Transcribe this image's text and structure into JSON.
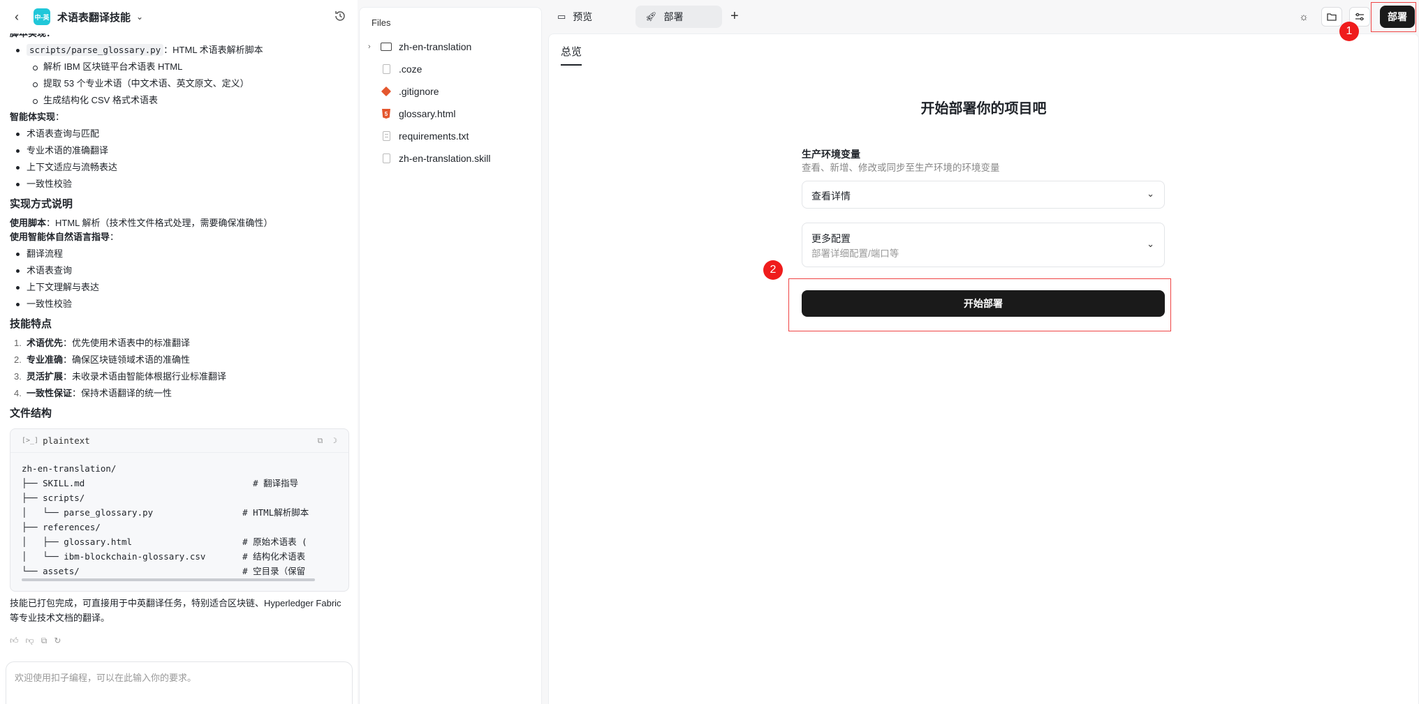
{
  "header": {
    "app_title": "术语表翻译技能",
    "app_logo_text": "中-英"
  },
  "chat": {
    "cut_heading": "脚本实现：",
    "script_item_code": "scripts/parse_glossary.py",
    "script_item_text": "：HTML 术语表解析脚本",
    "script_sub": [
      "解析 IBM 区块链平台术语表 HTML",
      "提取 53 个专业术语（中文术语、英文原文、定义）",
      "生成结构化 CSV 格式术语表"
    ],
    "agent_heading": "智能体实现",
    "agent_heading_colon": "：",
    "agent_items": [
      "术语表查询与匹配",
      "专业术语的准确翻译",
      "上下文适应与流畅表达",
      "一致性校验"
    ],
    "impl_title": "实现方式说明",
    "use_script_label": "使用脚本",
    "use_script_text": "：HTML 解析（技术性文件格式处理，需要确保准确性）",
    "use_agent_label": "使用智能体自然语言指导",
    "use_agent_colon": "：",
    "use_agent_items": [
      "翻译流程",
      "术语表查询",
      "上下文理解与表达",
      "一致性校验"
    ],
    "features_title": "技能特点",
    "features": [
      {
        "n": "1.",
        "label": "术语优先",
        "text": "：优先使用术语表中的标准翻译"
      },
      {
        "n": "2.",
        "label": "专业准确",
        "text": "：确保区块链领域术语的准确性"
      },
      {
        "n": "3.",
        "label": "灵活扩展",
        "text": "：未收录术语由智能体根据行业标准翻译"
      },
      {
        "n": "4.",
        "label": "一致性保证",
        "text": "：保持术语翻译的统一性"
      }
    ],
    "structure_title": "文件结构",
    "code_lang": "plaintext",
    "code_text": "zh-en-translation/\n├── SKILL.md                                # 翻译指导\n├── scripts/\n│   └── parse_glossary.py                 # HTML解析脚本\n├── references/\n│   ├── glossary.html                     # 原始术语表 (\n│   └── ibm-blockchain-glossary.csv       # 结构化术语表\n└── assets/                               # 空目录（保留",
    "after_text": "技能已打包完成，可直接用于中英翻译任务，特别适合区块链、Hyperledger Fabric 等专业技术文档的翻译。",
    "input_placeholder": "欢迎使用扣子编程，可以在此输入你的要求。"
  },
  "files": {
    "title": "Files",
    "items": [
      {
        "name": "zh-en-translation",
        "icon": "folder-icon"
      },
      {
        "name": ".coze",
        "icon": "file-icon"
      },
      {
        "name": ".gitignore",
        "icon": "git-icon"
      },
      {
        "name": "glossary.html",
        "icon": "html5-icon"
      },
      {
        "name": "requirements.txt",
        "icon": "text-file-icon"
      },
      {
        "name": "zh-en-translation.skill",
        "icon": "file-icon"
      }
    ]
  },
  "tabs": {
    "preview": "预览",
    "deploy": "部署"
  },
  "toolbar": {
    "deploy_label": "部署"
  },
  "markers": {
    "one": "1",
    "two": "2"
  },
  "deploy": {
    "overview_tab": "总览",
    "title": "开始部署你的项目吧",
    "env_label": "生产环境变量",
    "env_desc": "查看、新增、修改或同步至生产环境的环境变量",
    "env_details": "查看详情",
    "more_label": "更多配置",
    "more_desc": "部署详细配置/端口等",
    "start_button": "开始部署"
  },
  "colors": {
    "accent": "#1a1a1a",
    "marker": "#ef1c1c",
    "logo": "#20c7d9"
  }
}
